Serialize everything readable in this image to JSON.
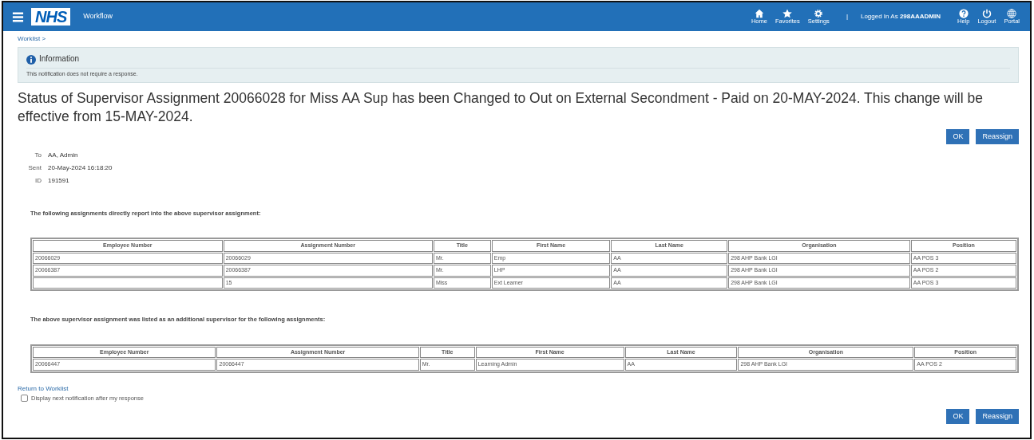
{
  "header": {
    "logo": "NHS",
    "app_title": "Workflow",
    "nav": [
      {
        "label": "Home"
      },
      {
        "label": "Favorites"
      },
      {
        "label": "Settings"
      }
    ],
    "separator": "|",
    "user_prefix": "Logged In As",
    "user": "298AAADMIN",
    "nav_right": [
      {
        "label": "Help"
      },
      {
        "label": "Logout"
      },
      {
        "label": "Portal"
      }
    ]
  },
  "breadcrumb": "Worklist >",
  "info": {
    "title": "Information",
    "message": "This notification does not require a response."
  },
  "heading": "Status of Supervisor Assignment 20066028 for Miss AA Sup has been Changed to Out on External Secondment - Paid on 20-MAY-2024. This change will be effective from 15-MAY-2024.",
  "buttons_top": [
    "OK",
    "Reassign"
  ],
  "details": [
    {
      "label": "To",
      "value": "AA, Admin"
    },
    {
      "label": "Sent",
      "value": "20-May-2024 16:18:20"
    },
    {
      "label": "ID",
      "value": "191591"
    }
  ],
  "sections": [
    {
      "text": "The following assignments directly report into the above supervisor assignment:",
      "columns": [
        "Employee Number",
        "Assignment Number",
        "Title",
        "First Name",
        "Last Name",
        "Organisation",
        "Position"
      ],
      "rows": [
        [
          "20066029",
          "20066029",
          "Mr.",
          "Emp",
          "AA",
          "298 AHP Bank LGI",
          "AA POS 3"
        ],
        [
          "20066387",
          "20066387",
          "Mr.",
          "LHP",
          "AA",
          "298 AHP Bank LGI",
          "AA POS 2"
        ],
        [
          "",
          "15",
          "Miss",
          "Ext Learner",
          "AA",
          "298 AHP Bank LGI",
          "AA POS 3"
        ]
      ]
    },
    {
      "text": "The above supervisor assignment was listed as an additional supervisor for the following assignments:",
      "columns": [
        "Employee Number",
        "Assignment Number",
        "Title",
        "First Name",
        "Last Name",
        "Organisation",
        "Position"
      ],
      "rows": [
        [
          "20066447",
          "20066447",
          "Mr.",
          "Learning Admin",
          "AA",
          "298 AHP Bank LGI",
          "AA POS 2"
        ]
      ]
    }
  ],
  "return_link": "Return to Worklist",
  "checkbox": {
    "label": "Display next notification after my response",
    "checked": false
  },
  "buttons_bottom": [
    "OK",
    "Reassign"
  ]
}
